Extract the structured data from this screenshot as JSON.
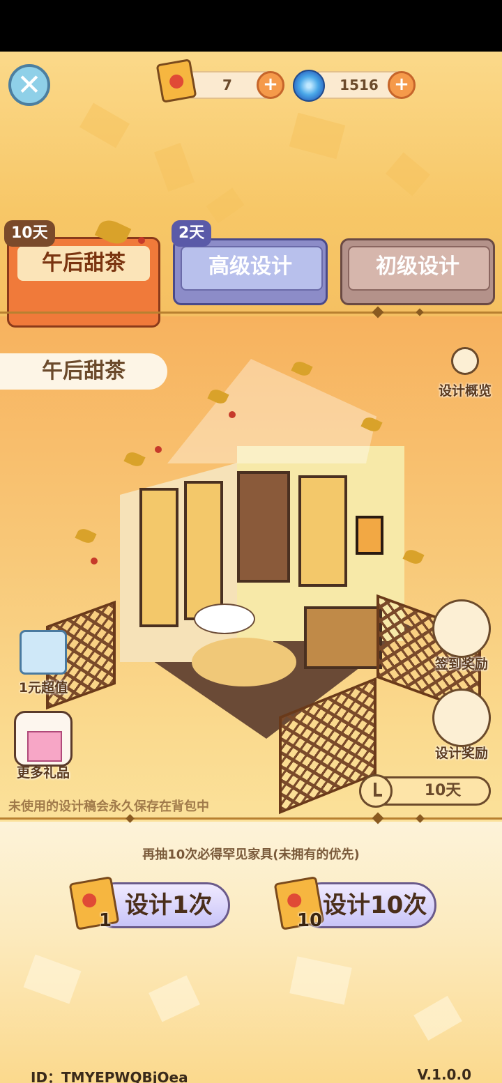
{
  "resources": {
    "tickets": "7",
    "gems": "1516",
    "plus": "+"
  },
  "tabs": [
    {
      "label": "午后甜茶",
      "days": "10天"
    },
    {
      "label": "高级设计",
      "days": "2天"
    },
    {
      "label": "初级设计"
    }
  ],
  "banner": {
    "title": "午后甜茶"
  },
  "side": {
    "overview": "设计概览",
    "checkin": "签到奖励",
    "design_reward": "设计奖励",
    "value_pack": "1元超值",
    "more_gifts": "更多礼品"
  },
  "note": "未使用的设计稿会永久保存在背包中",
  "timer": {
    "days": "10天"
  },
  "hint": "再抽10次必得罕见家具(未拥有的优先)",
  "draw": [
    {
      "label": "设计1次",
      "cost": "1"
    },
    {
      "label": "设计10次",
      "cost": "10"
    }
  ],
  "footer": {
    "id": "ID：TMYEPWQBjOea",
    "version": "V.1.0.0"
  },
  "colors": {
    "accent_orange": "#f07a3a",
    "purple_tab": "#8c8cc8",
    "brown_tab": "#b4928a"
  }
}
